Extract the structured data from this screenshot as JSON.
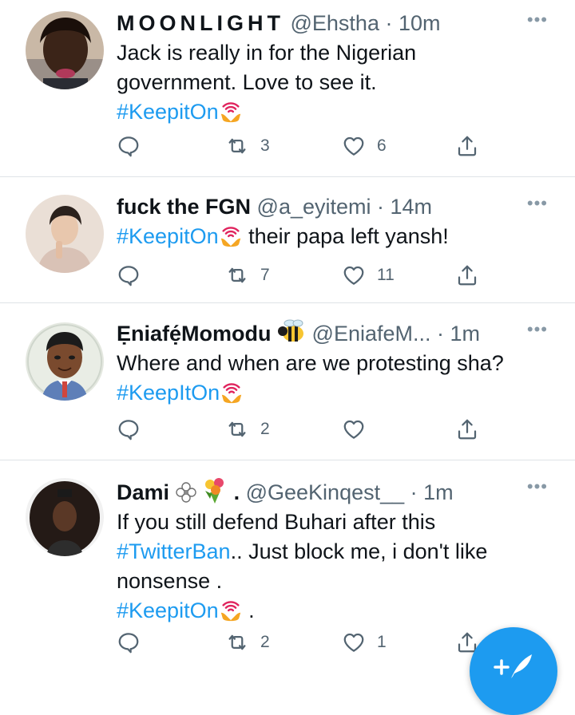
{
  "colors": {
    "accent": "#1d9bf0",
    "text": "#0f1419",
    "secondary": "#536471",
    "divider": "#dfe3e7"
  },
  "tweets": [
    {
      "name": "MOONLIGHT",
      "handle": "@Ehstha",
      "time": "· 10m",
      "lines": [
        "Jack is really in for the Nigerian",
        "government. Love to see it."
      ],
      "hashtag": "#KeepitOn",
      "replies": "",
      "retweets": "3",
      "likes": "6"
    },
    {
      "name": "fuck the FGN",
      "handle": "@a_eyitemi",
      "time": "· 14m",
      "hashtag": "#KeepitOn",
      "after_tag": "their papa left yansh!",
      "replies": "",
      "retweets": "7",
      "likes": "11"
    },
    {
      "name": "Ẹniafẹ́Momodu",
      "handle": "@EniafeM...",
      "time": "· 1m",
      "lines": [
        "Where and when are we protesting sha?"
      ],
      "hashtag": "#KeepItOn",
      "replies": "",
      "retweets": "2",
      "likes": ""
    },
    {
      "name": "Dami",
      "name_suffix": ".",
      "handle": "@GeeKinqest__",
      "time": "· 1m",
      "lines": [
        "If you still defend Buhari after this"
      ],
      "hashtag_inline": "#TwitterBan",
      "line2_rest": ".. Just block me, i don't like",
      "line3": "nonsense .",
      "hashtag": "#KeepitOn",
      "hashtag_after": " .",
      "replies": "",
      "retweets": "2",
      "likes": "1"
    }
  ],
  "more_label": "•••",
  "icons": {
    "reply": "reply-icon",
    "retweet": "retweet-icon",
    "like": "heart-icon",
    "share": "share-icon",
    "compose": "compose-tweet-icon"
  }
}
